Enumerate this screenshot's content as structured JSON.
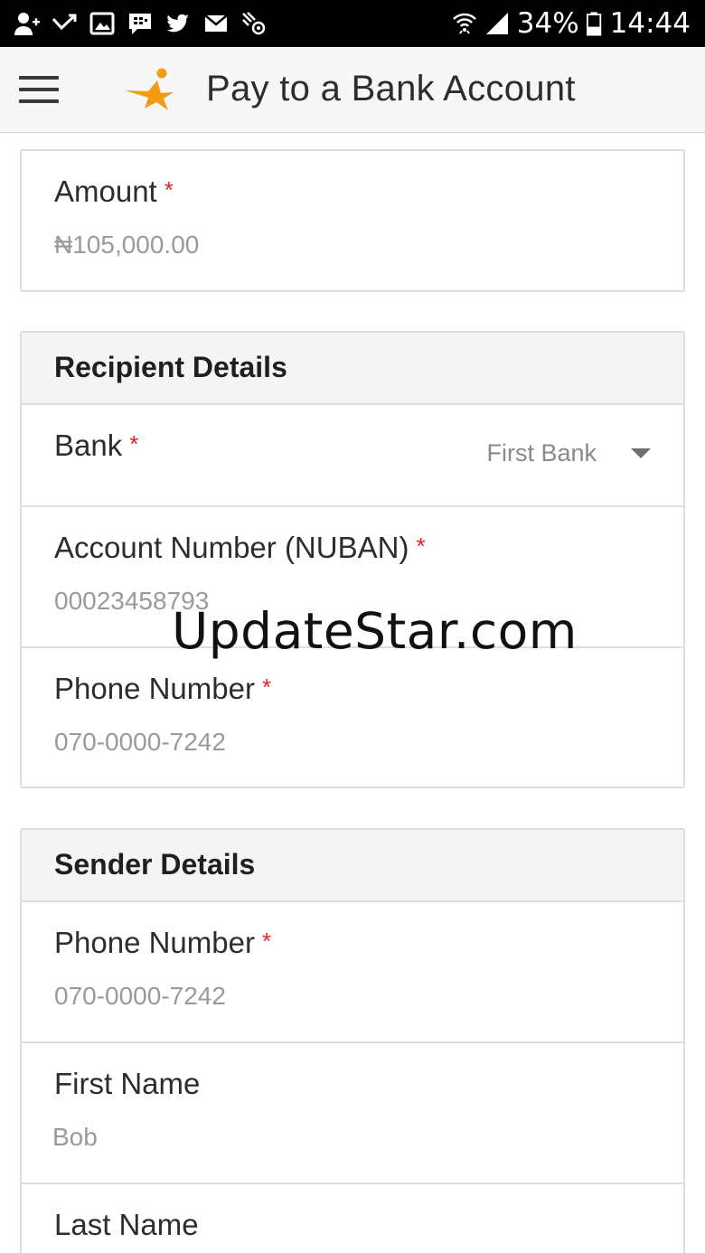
{
  "status_bar": {
    "left_icons": [
      "add-contact-icon",
      "missed-call-icon",
      "image-icon",
      "bbm-icon",
      "twitter-icon",
      "email-icon",
      "satellite-icon"
    ],
    "battery_percent": "34%",
    "time": "14:44",
    "right_icons": [
      "wifi-icon",
      "signal-icon",
      "battery-icon"
    ]
  },
  "app_bar": {
    "title": "Pay to a Bank Account",
    "logo_color": "#f39c12"
  },
  "amount_card": {
    "label": "Amount",
    "required": "*",
    "value": "₦105,000.00"
  },
  "recipient": {
    "header": "Recipient Details",
    "bank_label": "Bank",
    "bank_value": "First Bank",
    "account_label": "Account Number (NUBAN)",
    "account_value": "00023458793",
    "phone_label": "Phone Number",
    "phone_value": "070-0000-7242"
  },
  "sender": {
    "header": "Sender Details",
    "phone_label": "Phone Number",
    "phone_value": "070-0000-7242",
    "first_name_label": "First Name",
    "first_name_value": "Bob",
    "last_name_label": "Last Name"
  },
  "watermark": "UpdateStar.com",
  "colors": {
    "required": "#e0242a",
    "header_bg": "#f4f4f4",
    "border": "#dedede"
  }
}
